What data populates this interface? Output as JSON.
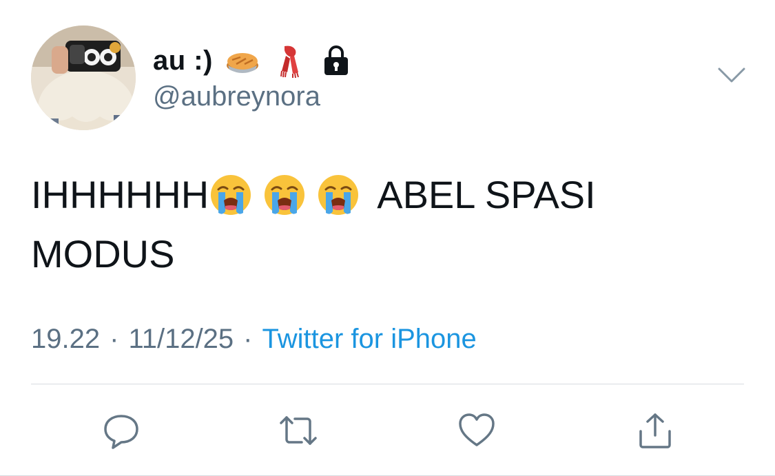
{
  "user": {
    "display_name": "au :)",
    "name_emojis": [
      "pie-emoji",
      "scarf-emoji",
      "lock-icon"
    ],
    "handle": "@aubreynora"
  },
  "tweet": {
    "line1_start": "IHHHHHH",
    "line1_end": "ABEL SPASI",
    "line2": "MODUS",
    "emojis": [
      "loudly-crying-face-emoji",
      "loudly-crying-face-emoji",
      "loudly-crying-face-emoji"
    ]
  },
  "meta": {
    "time": "19.22",
    "separator": "·",
    "date": "11/12/25",
    "source": "Twitter for iPhone"
  },
  "actions": [
    "reply-icon",
    "retweet-icon",
    "like-icon",
    "share-icon"
  ],
  "colors": {
    "text": "#0f1419",
    "secondary": "#5b7083",
    "link": "#1b95e0",
    "divider": "#d6dbe0"
  }
}
